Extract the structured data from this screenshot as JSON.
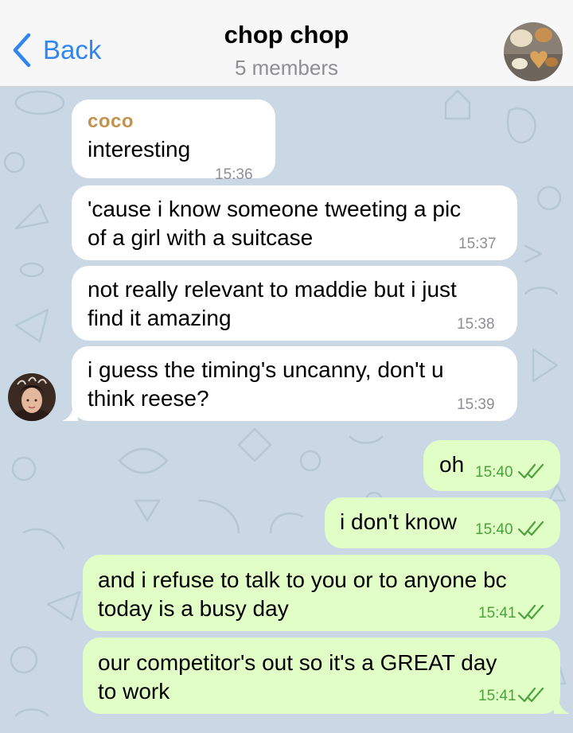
{
  "header": {
    "back_label": "Back",
    "title": "chop chop",
    "subtitle": "5 members"
  },
  "messages": [
    {
      "sender": "coco",
      "text": "interesting",
      "time": "15:36",
      "direction": "in"
    },
    {
      "text": "'cause i know someone tweeting a pic\nof a girl with a suitcase",
      "time": "15:37",
      "direction": "in"
    },
    {
      "text": "not really relevant to maddie but i just\nfind it amazing",
      "time": "15:38",
      "direction": "in"
    },
    {
      "text": "i guess the timing's uncanny, don't u\nthink reese?",
      "time": "15:39",
      "direction": "in"
    },
    {
      "text": "oh",
      "time": "15:40",
      "direction": "out",
      "status": "read"
    },
    {
      "text": "i don't know",
      "time": "15:40",
      "direction": "out",
      "status": "read"
    },
    {
      "text": "and i refuse to talk to you or to anyone bc\ntoday is a busy day",
      "time": "15:41",
      "direction": "out",
      "status": "read"
    },
    {
      "text": "our competitor's out so it's a GREAT day\nto work",
      "time": "15:41",
      "direction": "out",
      "status": "read"
    }
  ],
  "colors": {
    "accent": "#2f86f0",
    "incoming_bubble": "#ffffff",
    "outgoing_bubble": "#e1fec6",
    "outgoing_time": "#4aa33b",
    "sender_name": "#c3914e",
    "wallpaper": "#c9d8e4"
  },
  "icons": [
    "chevron-left-icon",
    "double-check-icon"
  ]
}
